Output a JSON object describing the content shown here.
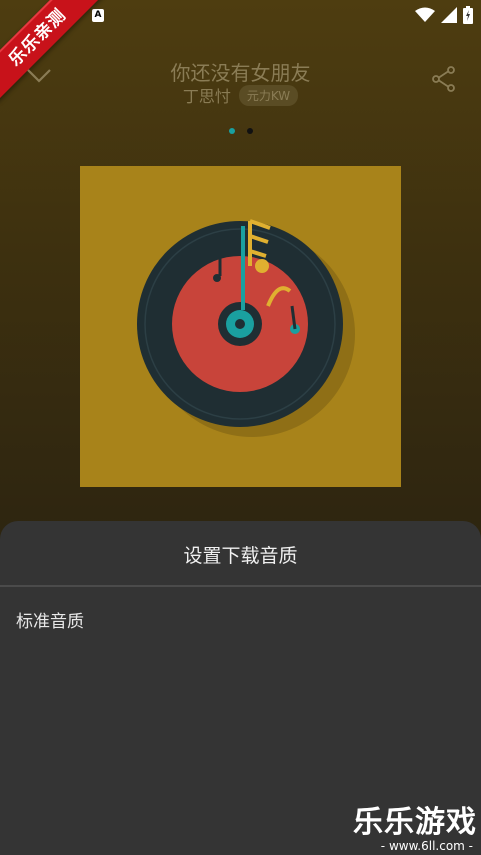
{
  "ribbon": {
    "text": "乐乐亲测"
  },
  "status_bar": {
    "left_icon": "A",
    "icons": [
      "wifi-icon",
      "signal-icon",
      "battery-icon"
    ]
  },
  "header": {
    "title": "你还没有女朋友",
    "artist": "丁思忖",
    "badge": "元力KW"
  },
  "pager": {
    "count": 2,
    "active_index": 0,
    "active_color": "#1aa0a0",
    "inactive_color": "#111111"
  },
  "album": {
    "background": "#a8831a",
    "record_label": "#c8443a",
    "record": "#1f2e33"
  },
  "sheet": {
    "title": "设置下载音质",
    "options": [
      "标准音质"
    ]
  },
  "watermark": {
    "title": "乐乐游戏",
    "url": "- www.6ll.com -"
  }
}
